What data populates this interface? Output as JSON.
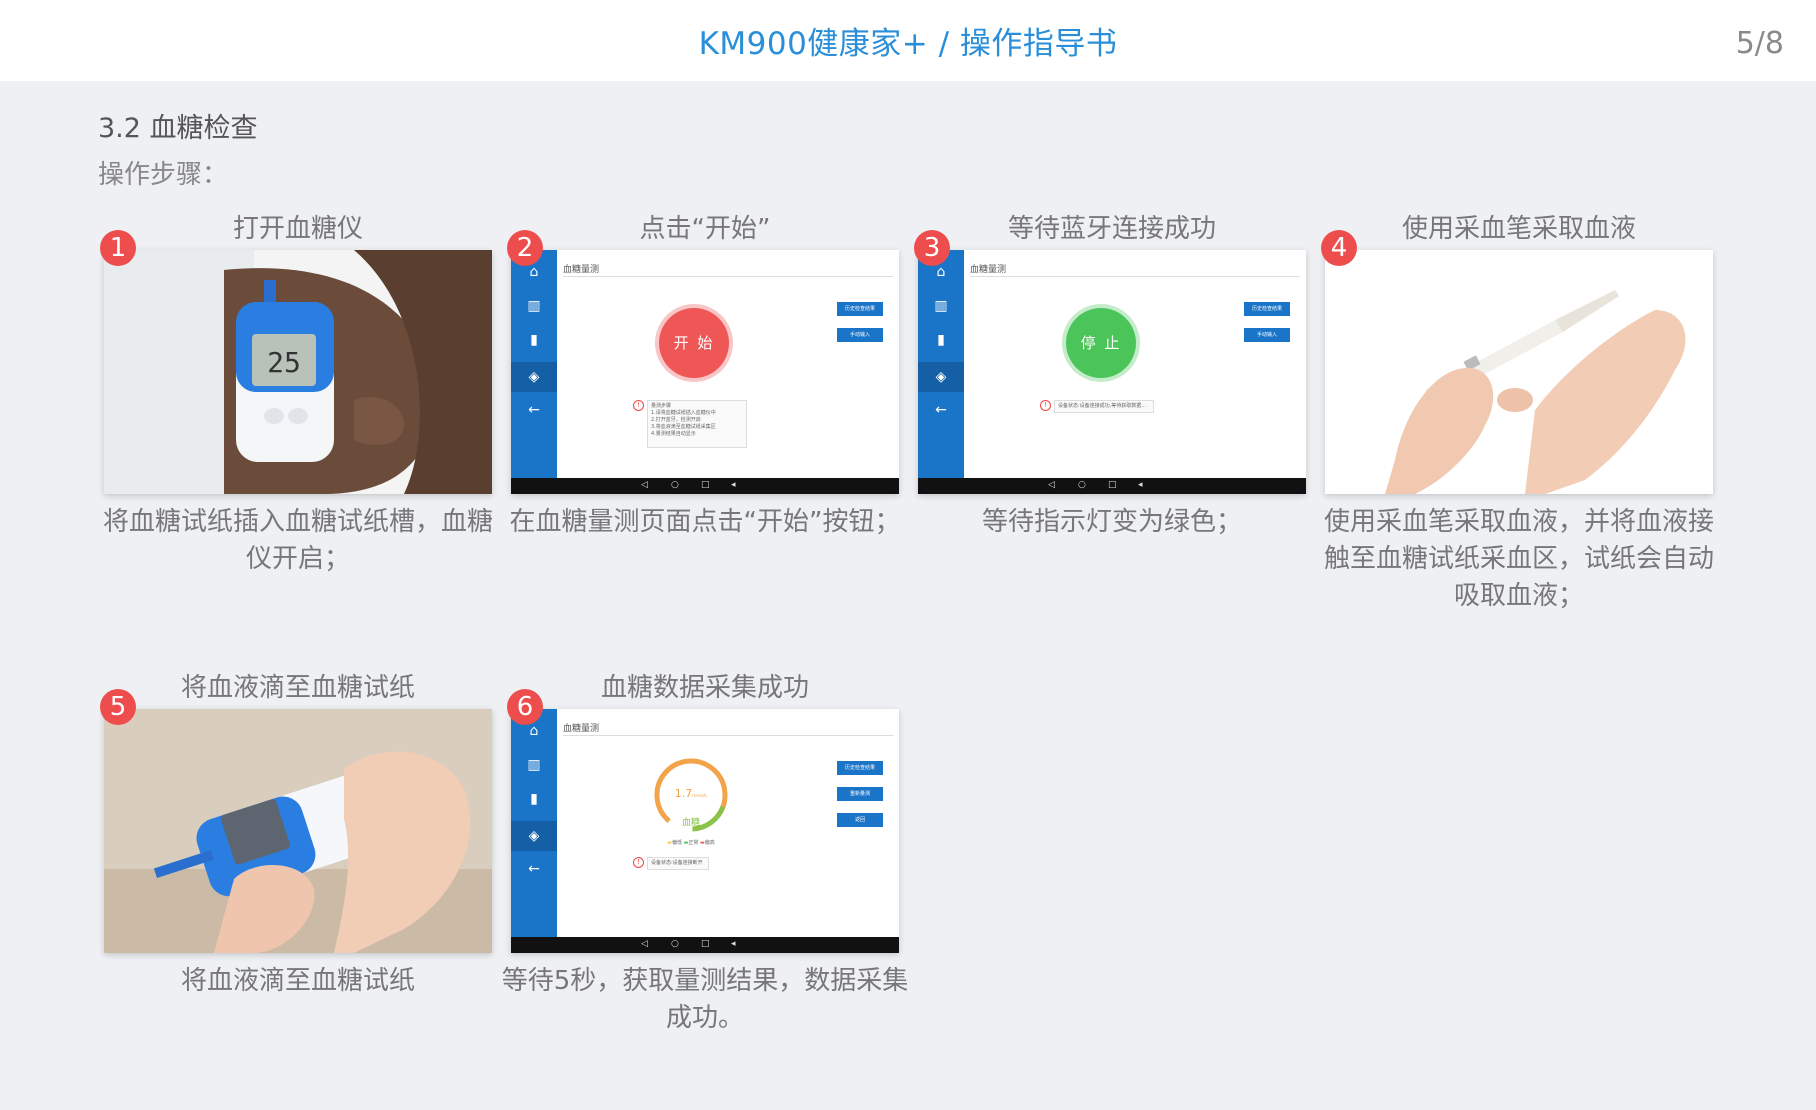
{
  "header": {
    "title": "KM900健康家+ / 操作指导书",
    "page": "5/8"
  },
  "section": {
    "title": "3.2 血糖检查",
    "steps_label": "操作步骤："
  },
  "steps": [
    {
      "num": "1",
      "title": "打开血糖仪",
      "desc": "将血糖试纸插入血糖试纸槽，血糖仪开启；",
      "image": "meter-photo"
    },
    {
      "num": "2",
      "title": "点击“开始”",
      "desc": "在血糖量测页面点击“开始”按钮；",
      "image": "tablet-start"
    },
    {
      "num": "3",
      "title": "等待蓝牙连接成功",
      "desc": "等待指示灯变为绿色；",
      "image": "tablet-stop"
    },
    {
      "num": "4",
      "title": "使用采血笔采取血液",
      "desc": "使用采血笔采取血液，并将血液接触至血糖试纸采血区，试纸会自动吸取血液；",
      "image": "lancet-photo"
    },
    {
      "num": "5",
      "title": "将血液滴至血糖试纸",
      "desc": "将血液滴至血糖试纸",
      "image": "blood-strip-photo"
    },
    {
      "num": "6",
      "title": "血糖数据采集成功",
      "desc": "等待5秒，获取量测结果，数据采集成功。",
      "image": "tablet-result"
    }
  ],
  "screens": {
    "screen_title": "血糖量测",
    "start_label": "开 始",
    "stop_label": "停 止",
    "history_btn": "历史检查结果",
    "manual_btn": "手动输入",
    "remeasure_btn": "重新量测",
    "back_btn": "返回",
    "result_value": "1.7",
    "result_unit": "mmol/L",
    "result_label": "血糖",
    "legend_low": "偏低",
    "legend_normal": "正常",
    "legend_high": "偏高",
    "tips_title": "量测步骤",
    "tip_1": "1.请将血糖试纸插入血糖仪中",
    "tip_2": "2.打开蓝牙，检测开启",
    "tip_3": "3.将血液滴至血糖试纸采集区",
    "tip_4": "4.量测结果自动显示",
    "status_connecting": "设备状态:设备连接成功,等待获取数据...",
    "status_done": "设备状态:设备连接断开",
    "meter_reading": "25"
  },
  "colors": {
    "accent": "#2a8fd8",
    "badge": "#ee4d4d",
    "start": "#ef5656",
    "stop": "#4bc45a",
    "sidebar": "#1a74c8"
  }
}
